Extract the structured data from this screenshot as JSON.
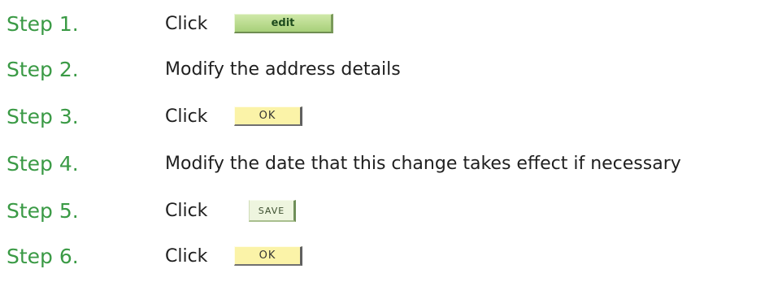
{
  "steps": [
    {
      "label": "Step 1.",
      "text": "Click",
      "button": "edit"
    },
    {
      "label": "Step 2.",
      "text": "Modify the address details"
    },
    {
      "label": "Step 3.",
      "text": "Click",
      "button": "OK"
    },
    {
      "label": "Step 4.",
      "text": "Modify the date that this change takes effect if necessary"
    },
    {
      "label": "Step 5.",
      "text": "Click",
      "button": "SAVE"
    },
    {
      "label": "Step 6.",
      "text": "Click",
      "button": "OK"
    }
  ]
}
